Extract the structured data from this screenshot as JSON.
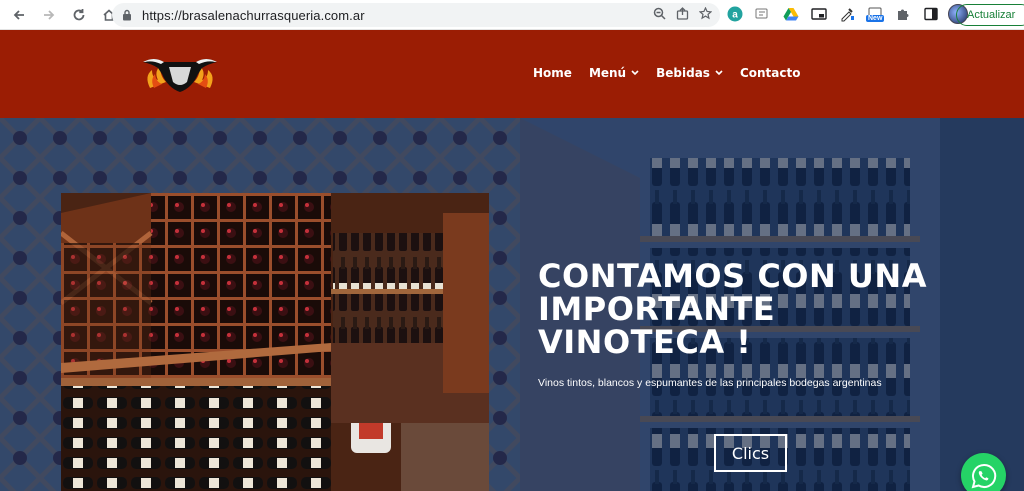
{
  "browser": {
    "url": "https://brasalenachurrasqueria.com.ar",
    "update_label": "Actualizar",
    "new_badge": "New"
  },
  "site": {
    "brand_color": "#9b1d04",
    "nav": [
      {
        "label": "Home"
      },
      {
        "label": "Menú",
        "icon": "chevron-down-icon"
      },
      {
        "label": "Bebidas",
        "icon": "chevron-down-icon"
      },
      {
        "label": "Contacto"
      }
    ]
  },
  "hero": {
    "title_lines": [
      "CONTAMOS CON UNA",
      "IMPORTANTE",
      "VINOTECA !"
    ],
    "subtitle": "Vinos tintos, blancos y espumantes de las principales bodegas argentinas",
    "cta_label": "Clics",
    "whatsapp_color": "#25d366"
  }
}
